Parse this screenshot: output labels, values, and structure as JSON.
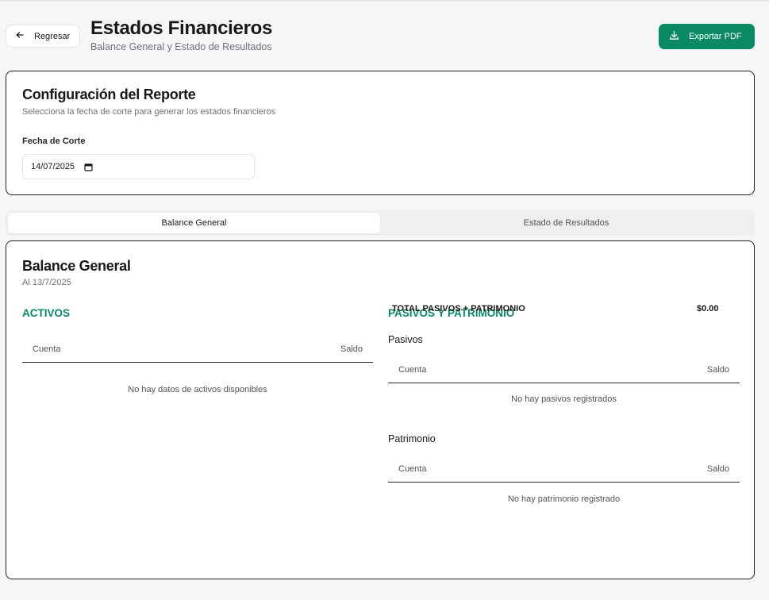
{
  "header": {
    "back_label": "Regresar",
    "title": "Estados Financieros",
    "subtitle": "Balance General y Estado de Resultados",
    "export_label": "Exportar PDF",
    "accent_color": "#0a8a63"
  },
  "config": {
    "title": "Configuración del Reporte",
    "description": "Selecciona la fecha de corte para generar los estados financieros",
    "date_label": "Fecha de Corte",
    "date_value": "14/07/2025"
  },
  "tabs": [
    {
      "label": "Balance General",
      "active": true
    },
    {
      "label": "Estado de Resultados",
      "active": false
    }
  ],
  "balance": {
    "title": "Balance General",
    "as_of": "Al 13/7/2025",
    "assets": {
      "heading": "ACTIVOS",
      "col_account": "Cuenta",
      "col_balance": "Saldo",
      "empty": "No hay datos de activos disponibles"
    },
    "liabilities_equity": {
      "heading": "PASIVOS Y PATRIMONIO",
      "liabilities": {
        "title": "Pasivos",
        "col_account": "Cuenta",
        "col_balance": "Saldo",
        "empty": "No hay pasivos registrados"
      },
      "equity": {
        "title": "Patrimonio",
        "col_account": "Cuenta",
        "col_balance": "Saldo",
        "empty": "No hay patrimonio registrado"
      },
      "total_label": "TOTAL PASIVOS + PATRIMONIO",
      "total_value": "$0.00"
    }
  }
}
